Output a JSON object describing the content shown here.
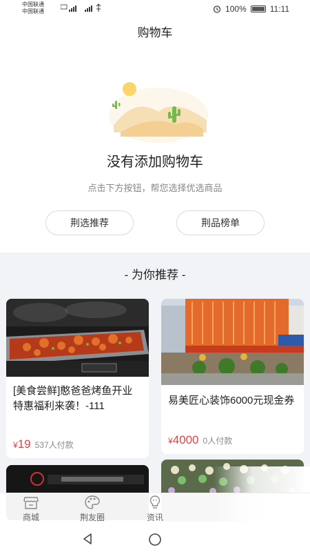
{
  "status_bar": {
    "carrier1": "中国联通",
    "carrier2": "中国联通",
    "battery": "100%",
    "time": "11:11"
  },
  "header": {
    "title": "购物车"
  },
  "empty_state": {
    "title": "没有添加购物车",
    "subtitle": "点击下方按钮，帮您选择优选商品",
    "illustration_icon": "desert-cactus-icon"
  },
  "buttons": {
    "left": "荆选推荐",
    "right": "荆品榜单"
  },
  "recommend": {
    "title": "- 为你推荐 -",
    "items": [
      {
        "title": "[美食尝鲜]憨爸爸烤鱼开业特惠福利来袭！-111",
        "currency": "¥",
        "price": "19",
        "paid": "537人付款"
      },
      {
        "title": "易美匠心装饰6000元现金券",
        "currency": "¥",
        "price": "4000",
        "paid": "0人付款"
      }
    ]
  },
  "tab_bar": {
    "items": [
      {
        "label": "商城",
        "icon": "store-icon"
      },
      {
        "label": "荆友圈",
        "icon": "palette-icon"
      },
      {
        "label": "资讯",
        "icon": "bulb-icon"
      }
    ]
  },
  "colors": {
    "accent": "#e8423f",
    "background": "#f2f3f7"
  }
}
